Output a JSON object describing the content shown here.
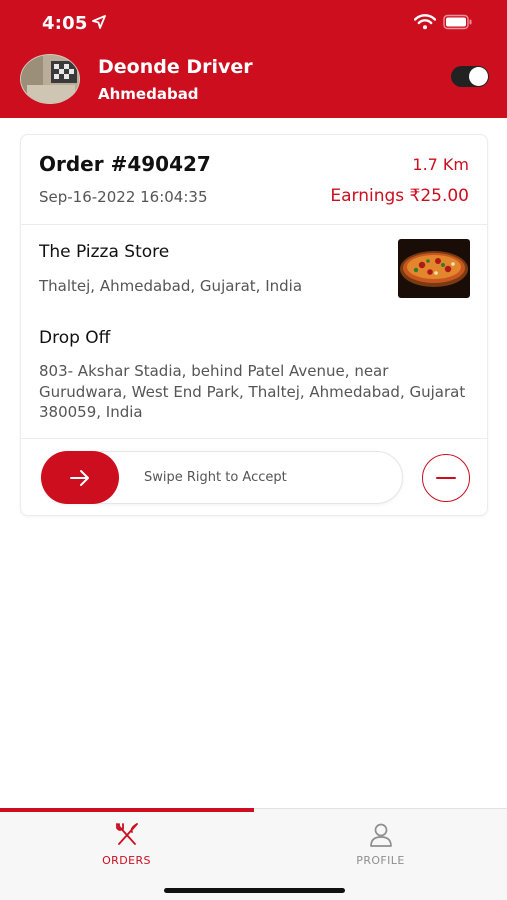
{
  "status_bar": {
    "time": "4:05"
  },
  "header": {
    "driver_name": "Deonde Driver",
    "driver_city": "Ahmedabad",
    "online_toggle": "on"
  },
  "order": {
    "id_label": "Order #490427",
    "distance": "1.7 Km",
    "date": "Sep-16-2022 16:04:35",
    "earnings": "Earnings ₹25.00",
    "store_name": "The Pizza Store",
    "store_address": "Thaltej, Ahmedabad, Gujarat, India",
    "drop_title": "Drop Off",
    "drop_address": "803- Akshar Stadia, behind Patel Avenue, near Gurudwara, West End Park, Thaltej, Ahmedabad, Gujarat 380059, India",
    "swipe_label": "Swipe Right to Accept"
  },
  "tabs": [
    {
      "label": "ORDERS",
      "icon": "fork-knife-icon",
      "active": true
    },
    {
      "label": "PROFILE",
      "icon": "person-icon",
      "active": false
    }
  ],
  "colors": {
    "brand": "#cc0e1f",
    "text": "#111111",
    "muted": "#555555"
  }
}
